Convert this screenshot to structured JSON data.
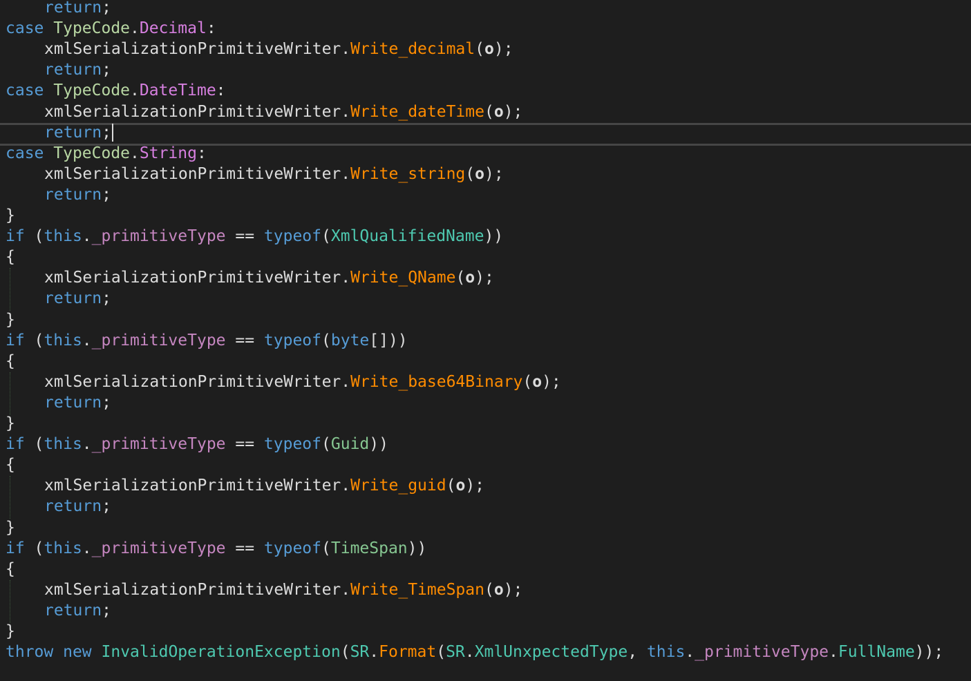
{
  "editor": {
    "background": "#1e1e1e",
    "lines": [
      {
        "id": "l0",
        "indent": 1,
        "tokens": [
          {
            "c": "ctrl",
            "t": "return"
          },
          {
            "c": "p",
            "t": ";"
          }
        ]
      },
      {
        "id": "l1",
        "indent": 0,
        "tokens": [
          {
            "c": "ctrl",
            "t": "case "
          },
          {
            "c": "enumtype",
            "t": "TypeCode"
          },
          {
            "c": "p",
            "t": "."
          },
          {
            "c": "enumv",
            "t": "Decimal"
          },
          {
            "c": "p",
            "t": ":"
          }
        ]
      },
      {
        "id": "l2",
        "indent": 1,
        "tokens": [
          {
            "c": "p",
            "t": "xmlSerializationPrimitiveWriter."
          },
          {
            "c": "method",
            "t": "Write_decimal"
          },
          {
            "c": "p",
            "t": "("
          },
          {
            "c": "local",
            "t": "o"
          },
          {
            "c": "p",
            "t": ");"
          }
        ]
      },
      {
        "id": "l3",
        "indent": 1,
        "tokens": [
          {
            "c": "ctrl",
            "t": "return"
          },
          {
            "c": "p",
            "t": ";"
          }
        ]
      },
      {
        "id": "l4",
        "indent": 0,
        "tokens": [
          {
            "c": "ctrl",
            "t": "case "
          },
          {
            "c": "enumtype",
            "t": "TypeCode"
          },
          {
            "c": "p",
            "t": "."
          },
          {
            "c": "enumv",
            "t": "DateTime"
          },
          {
            "c": "p",
            "t": ":"
          }
        ]
      },
      {
        "id": "l5",
        "indent": 1,
        "tokens": [
          {
            "c": "p",
            "t": "xmlSerializationPrimitiveWriter."
          },
          {
            "c": "method",
            "t": "Write_dateTime"
          },
          {
            "c": "p",
            "t": "("
          },
          {
            "c": "local",
            "t": "o"
          },
          {
            "c": "p",
            "t": ");"
          }
        ]
      },
      {
        "id": "l6",
        "indent": 1,
        "tokens": [
          {
            "c": "ctrl",
            "t": "return"
          },
          {
            "c": "p",
            "t": ";"
          }
        ],
        "caret": true
      },
      {
        "id": "l7",
        "indent": 0,
        "tokens": [
          {
            "c": "ctrl",
            "t": "case "
          },
          {
            "c": "enumtype",
            "t": "TypeCode"
          },
          {
            "c": "p",
            "t": "."
          },
          {
            "c": "enumv",
            "t": "String"
          },
          {
            "c": "p",
            "t": ":"
          }
        ]
      },
      {
        "id": "l8",
        "indent": 1,
        "tokens": [
          {
            "c": "p",
            "t": "xmlSerializationPrimitiveWriter."
          },
          {
            "c": "method",
            "t": "Write_string"
          },
          {
            "c": "p",
            "t": "("
          },
          {
            "c": "local",
            "t": "o"
          },
          {
            "c": "p",
            "t": ");"
          }
        ]
      },
      {
        "id": "l9",
        "indent": 1,
        "tokens": [
          {
            "c": "ctrl",
            "t": "return"
          },
          {
            "c": "p",
            "t": ";"
          }
        ]
      },
      {
        "id": "l10",
        "indent": 0,
        "tokens": [
          {
            "c": "p",
            "t": "}"
          }
        ]
      },
      {
        "id": "l11",
        "indent": 0,
        "tokens": [
          {
            "c": "ctrl",
            "t": "if"
          },
          {
            "c": "p",
            "t": " ("
          },
          {
            "c": "kw",
            "t": "this"
          },
          {
            "c": "p",
            "t": "."
          },
          {
            "c": "priv",
            "t": "_primitiveType"
          },
          {
            "c": "p",
            "t": " == "
          },
          {
            "c": "kw",
            "t": "typeof"
          },
          {
            "c": "p",
            "t": "("
          },
          {
            "c": "type",
            "t": "XmlQualifiedName"
          },
          {
            "c": "p",
            "t": "))"
          }
        ]
      },
      {
        "id": "l12",
        "indent": 0,
        "tokens": [
          {
            "c": "p",
            "t": "{"
          }
        ]
      },
      {
        "id": "l13",
        "indent": 1,
        "tokens": [
          {
            "c": "p",
            "t": "xmlSerializationPrimitiveWriter."
          },
          {
            "c": "method",
            "t": "Write_QName"
          },
          {
            "c": "p",
            "t": "("
          },
          {
            "c": "local",
            "t": "o"
          },
          {
            "c": "p",
            "t": ");"
          }
        ]
      },
      {
        "id": "l14",
        "indent": 1,
        "tokens": [
          {
            "c": "ctrl",
            "t": "return"
          },
          {
            "c": "p",
            "t": ";"
          }
        ]
      },
      {
        "id": "l15",
        "indent": 0,
        "tokens": [
          {
            "c": "p",
            "t": "}"
          }
        ]
      },
      {
        "id": "l16",
        "indent": 0,
        "tokens": [
          {
            "c": "ctrl",
            "t": "if"
          },
          {
            "c": "p",
            "t": " ("
          },
          {
            "c": "kw",
            "t": "this"
          },
          {
            "c": "p",
            "t": "."
          },
          {
            "c": "priv",
            "t": "_primitiveType"
          },
          {
            "c": "p",
            "t": " == "
          },
          {
            "c": "kw",
            "t": "typeof"
          },
          {
            "c": "p",
            "t": "("
          },
          {
            "c": "kw",
            "t": "byte"
          },
          {
            "c": "p",
            "t": "[]))"
          }
        ]
      },
      {
        "id": "l17",
        "indent": 0,
        "tokens": [
          {
            "c": "p",
            "t": "{"
          }
        ]
      },
      {
        "id": "l18",
        "indent": 1,
        "tokens": [
          {
            "c": "p",
            "t": "xmlSerializationPrimitiveWriter."
          },
          {
            "c": "method",
            "t": "Write_base64Binary"
          },
          {
            "c": "p",
            "t": "("
          },
          {
            "c": "local",
            "t": "o"
          },
          {
            "c": "p",
            "t": ");"
          }
        ]
      },
      {
        "id": "l19",
        "indent": 1,
        "tokens": [
          {
            "c": "ctrl",
            "t": "return"
          },
          {
            "c": "p",
            "t": ";"
          }
        ]
      },
      {
        "id": "l20",
        "indent": 0,
        "tokens": [
          {
            "c": "p",
            "t": "}"
          }
        ]
      },
      {
        "id": "l21",
        "indent": 0,
        "tokens": [
          {
            "c": "ctrl",
            "t": "if"
          },
          {
            "c": "p",
            "t": " ("
          },
          {
            "c": "kw",
            "t": "this"
          },
          {
            "c": "p",
            "t": "."
          },
          {
            "c": "priv",
            "t": "_primitiveType"
          },
          {
            "c": "p",
            "t": " == "
          },
          {
            "c": "kw",
            "t": "typeof"
          },
          {
            "c": "p",
            "t": "("
          },
          {
            "c": "struct",
            "t": "Guid"
          },
          {
            "c": "p",
            "t": "))"
          }
        ]
      },
      {
        "id": "l22",
        "indent": 0,
        "tokens": [
          {
            "c": "p",
            "t": "{"
          }
        ]
      },
      {
        "id": "l23",
        "indent": 1,
        "tokens": [
          {
            "c": "p",
            "t": "xmlSerializationPrimitiveWriter."
          },
          {
            "c": "method",
            "t": "Write_guid"
          },
          {
            "c": "p",
            "t": "("
          },
          {
            "c": "local",
            "t": "o"
          },
          {
            "c": "p",
            "t": ");"
          }
        ]
      },
      {
        "id": "l24",
        "indent": 1,
        "tokens": [
          {
            "c": "ctrl",
            "t": "return"
          },
          {
            "c": "p",
            "t": ";"
          }
        ]
      },
      {
        "id": "l25",
        "indent": 0,
        "tokens": [
          {
            "c": "p",
            "t": "}"
          }
        ]
      },
      {
        "id": "l26",
        "indent": 0,
        "tokens": [
          {
            "c": "ctrl",
            "t": "if"
          },
          {
            "c": "p",
            "t": " ("
          },
          {
            "c": "kw",
            "t": "this"
          },
          {
            "c": "p",
            "t": "."
          },
          {
            "c": "priv",
            "t": "_primitiveType"
          },
          {
            "c": "p",
            "t": " == "
          },
          {
            "c": "kw",
            "t": "typeof"
          },
          {
            "c": "p",
            "t": "("
          },
          {
            "c": "struct",
            "t": "TimeSpan"
          },
          {
            "c": "p",
            "t": "))"
          }
        ]
      },
      {
        "id": "l27",
        "indent": 0,
        "tokens": [
          {
            "c": "p",
            "t": "{"
          }
        ]
      },
      {
        "id": "l28",
        "indent": 1,
        "tokens": [
          {
            "c": "p",
            "t": "xmlSerializationPrimitiveWriter."
          },
          {
            "c": "method",
            "t": "Write_TimeSpan"
          },
          {
            "c": "p",
            "t": "("
          },
          {
            "c": "local",
            "t": "o"
          },
          {
            "c": "p",
            "t": ");"
          }
        ]
      },
      {
        "id": "l29",
        "indent": 1,
        "tokens": [
          {
            "c": "ctrl",
            "t": "return"
          },
          {
            "c": "p",
            "t": ";"
          }
        ]
      },
      {
        "id": "l30",
        "indent": 0,
        "tokens": [
          {
            "c": "p",
            "t": "}"
          }
        ]
      },
      {
        "id": "l31",
        "indent": 0,
        "tokens": [
          {
            "c": "kw",
            "t": "throw"
          },
          {
            "c": "p",
            "t": " "
          },
          {
            "c": "kw",
            "t": "new"
          },
          {
            "c": "p",
            "t": " "
          },
          {
            "c": "type",
            "t": "InvalidOperationException"
          },
          {
            "c": "p",
            "t": "("
          },
          {
            "c": "type",
            "t": "SR"
          },
          {
            "c": "p",
            "t": "."
          },
          {
            "c": "method",
            "t": "Format"
          },
          {
            "c": "p",
            "t": "("
          },
          {
            "c": "type",
            "t": "SR"
          },
          {
            "c": "p",
            "t": "."
          },
          {
            "c": "type",
            "t": "XmlUnxpectedType"
          },
          {
            "c": "p",
            "t": ", "
          },
          {
            "c": "kw",
            "t": "this"
          },
          {
            "c": "p",
            "t": "."
          },
          {
            "c": "priv",
            "t": "_primitiveType"
          },
          {
            "c": "p",
            "t": "."
          },
          {
            "c": "prop",
            "t": "FullName"
          },
          {
            "c": "p",
            "t": "));"
          }
        ]
      }
    ]
  }
}
